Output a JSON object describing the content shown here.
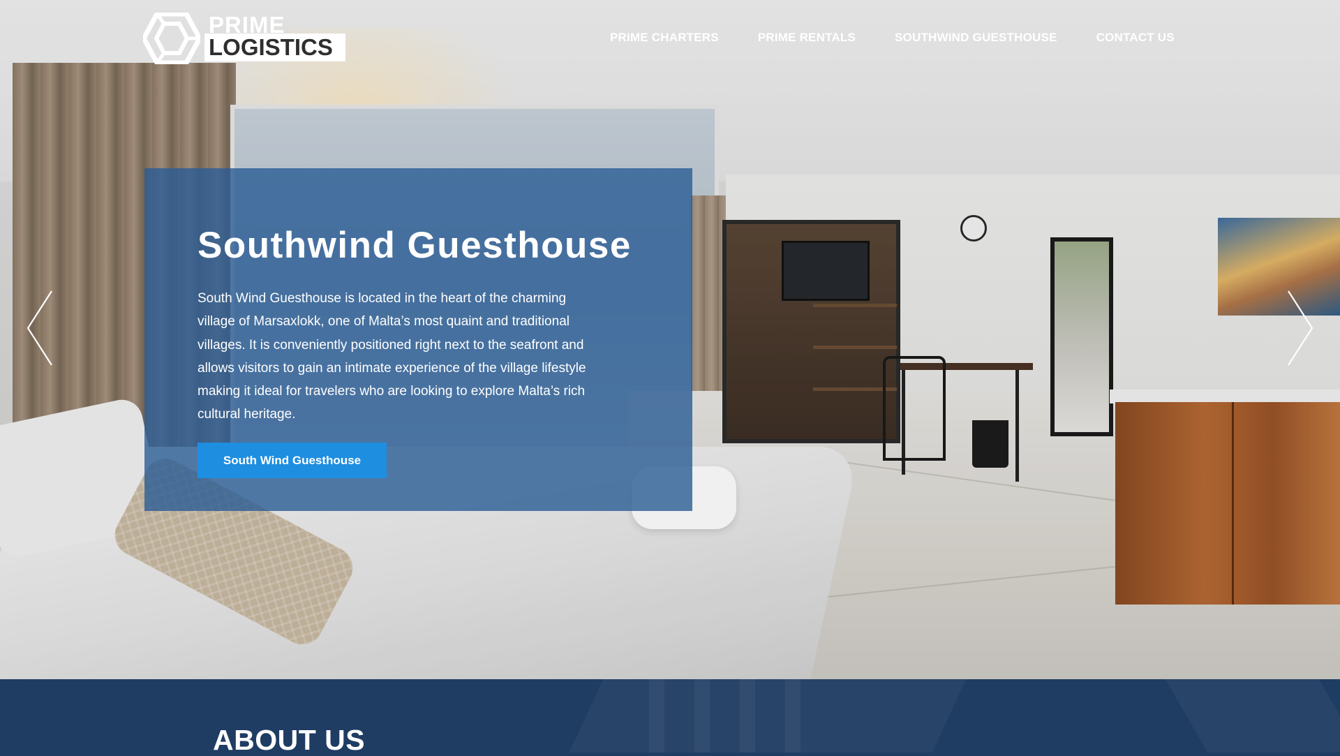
{
  "brand": {
    "logo_line1": "PRIME",
    "logo_line2": "LOGISTICS",
    "logo_icon": "hexagon-logo-icon"
  },
  "nav": {
    "items": [
      {
        "label": "PRIME CHARTERS"
      },
      {
        "label": "PRIME RENTALS"
      },
      {
        "label": "SOUTHWIND GUESTHOUSE"
      },
      {
        "label": "CONTACT US"
      }
    ]
  },
  "carousel": {
    "prev_icon": "chevron-left-icon",
    "next_icon": "chevron-right-icon",
    "slide": {
      "title": "Southwind Guesthouse",
      "description": "South Wind Guesthouse is located in the heart of the charming village of Marsaxlokk, one of Malta’s most quaint and traditional villages. It is conveniently positioned right next to the seafront and allows visitors to gain an intimate experience of the village lifestyle making it ideal for travelers who are looking to explore Malta’s rich cultural heritage.",
      "button_label": "South Wind Guesthouse"
    }
  },
  "about": {
    "heading": "ABOUT US"
  },
  "colors": {
    "card_overlay": "#2b5c95",
    "button": "#1e8ee0",
    "section_bg": "#1f3c63",
    "nav_text": "#ffffff"
  }
}
